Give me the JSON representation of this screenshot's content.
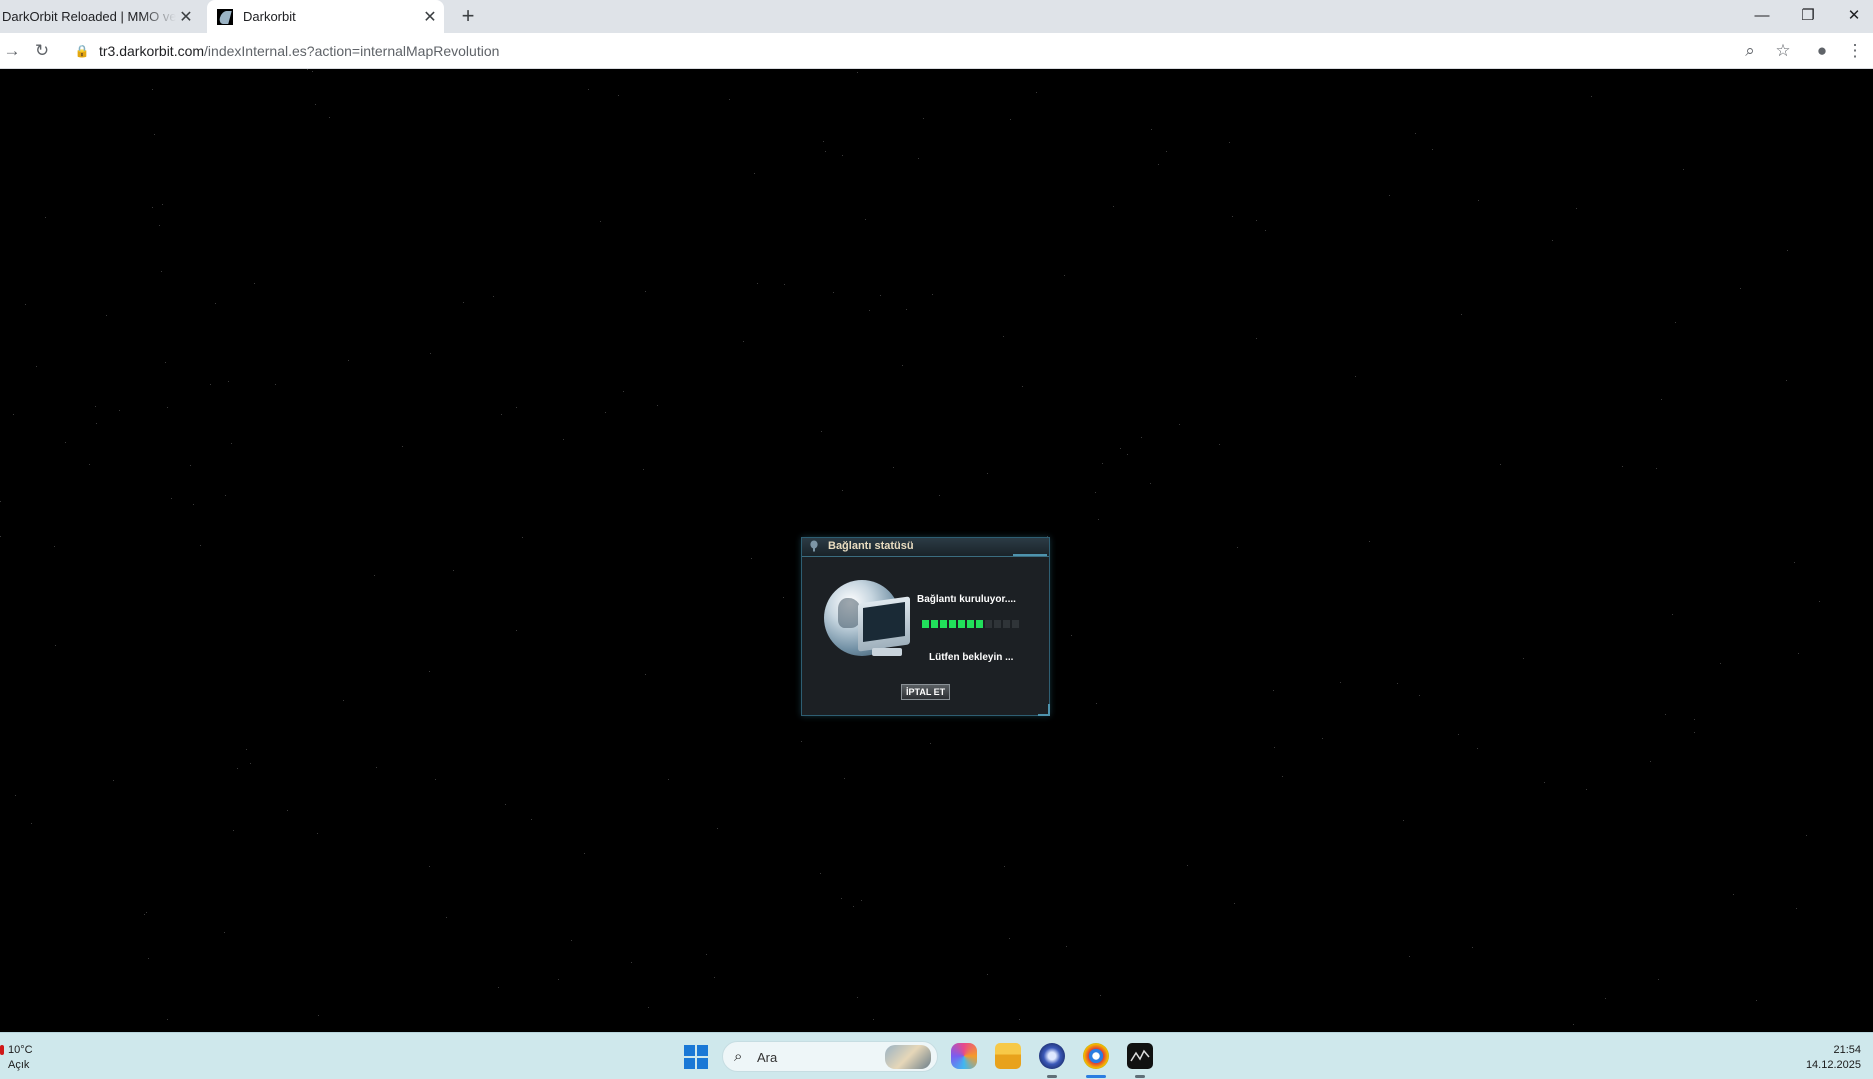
{
  "browser": {
    "tabs": [
      {
        "title": "DarkOrbit Reloaded | MMO ve Uz",
        "active": false
      },
      {
        "title": "Darkorbit",
        "active": true
      }
    ],
    "new_tab_icon": "plus-icon",
    "url_host": "tr3.darkorbit.com",
    "url_path": "/indexInternal.es?action=internalMapRevolution"
  },
  "dialog": {
    "title": "Bağlantı statüsü",
    "status_connecting": "Bağlantı kuruluyor....",
    "status_wait": "Lütfen bekleyin ...",
    "cancel_label": "İPTAL ET",
    "progress_filled": 7,
    "progress_total": 11,
    "progress_color": "#21e05b"
  },
  "taskbar": {
    "weather_temp": "10°C",
    "weather_desc": "Açık",
    "search_placeholder": "Ara",
    "clock_time": "21:54",
    "clock_date": "14.12.2025"
  }
}
